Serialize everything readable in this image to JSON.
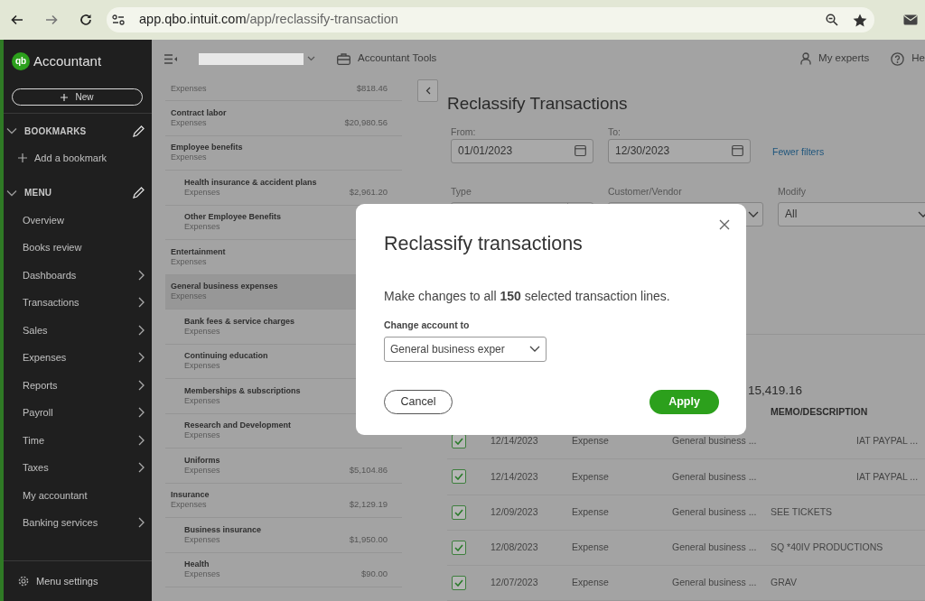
{
  "browser": {
    "url_host": "app.qbo.intuit.com",
    "url_path": "/app/reclassify-transaction"
  },
  "sidebar": {
    "logo_mark": "qb",
    "brand": "Accountant",
    "new_button": "New",
    "sections": [
      {
        "title": "BOOKMARKS",
        "expanded": true,
        "items": [
          {
            "label": "Add a bookmark",
            "kind": "add"
          }
        ]
      },
      {
        "title": "MENU",
        "expanded": true,
        "items": [
          {
            "label": "Overview",
            "kind": "link",
            "has_submenu": false
          },
          {
            "label": "Books review",
            "kind": "link",
            "has_submenu": false
          },
          {
            "label": "Dashboards",
            "kind": "link",
            "has_submenu": true
          },
          {
            "label": "Transactions",
            "kind": "link",
            "has_submenu": true
          },
          {
            "label": "Sales",
            "kind": "link",
            "has_submenu": true
          },
          {
            "label": "Expenses",
            "kind": "link",
            "has_submenu": true
          },
          {
            "label": "Reports",
            "kind": "link",
            "has_submenu": true
          },
          {
            "label": "Payroll",
            "kind": "link",
            "has_submenu": true
          },
          {
            "label": "Time",
            "kind": "link",
            "has_submenu": true
          },
          {
            "label": "Taxes",
            "kind": "link",
            "has_submenu": true
          },
          {
            "label": "My accountant",
            "kind": "link",
            "has_submenu": false
          },
          {
            "label": "Banking services",
            "kind": "link",
            "has_submenu": true
          }
        ]
      }
    ],
    "footer": "Menu settings"
  },
  "topbar": {
    "accountant_tools": "Accountant Tools",
    "my_experts": "My experts",
    "help": "He"
  },
  "accounts": [
    {
      "type": "Expenses",
      "amount": "$818.46",
      "selected": false
    },
    {
      "name": "Contract labor",
      "type": "Expenses",
      "amount": "$20,980.56",
      "selected": false
    },
    {
      "name": "Employee benefits",
      "type": "Expenses",
      "selected": false,
      "children": [
        {
          "name": "Health insurance & accident plans",
          "type": "Expenses",
          "amount": "$2,961.20",
          "selected": false
        },
        {
          "name": "Other Employee Benefits",
          "type": "Expenses",
          "selected": false
        }
      ]
    },
    {
      "name": "Entertainment",
      "type": "Expenses",
      "selected": false
    },
    {
      "name": "General business expenses",
      "type": "Expenses",
      "selected": true,
      "children": [
        {
          "name": "Bank fees & service charges",
          "type": "Expenses",
          "selected": false
        },
        {
          "name": "Continuing education",
          "type": "Expenses",
          "selected": false
        },
        {
          "name": "Memberships & subscriptions",
          "type": "Expenses",
          "selected": false
        },
        {
          "name": "Research and Development",
          "type": "Expenses",
          "selected": false
        },
        {
          "name": "Uniforms",
          "type": "Expenses",
          "amount": "$5,104.86",
          "selected": false
        }
      ]
    },
    {
      "name": "Insurance",
      "type": "Expenses",
      "amount": "$2,129.19",
      "selected": false,
      "children": [
        {
          "name": "Business insurance",
          "type": "Expenses",
          "amount": "$1,950.00",
          "selected": false
        },
        {
          "name": "Health",
          "type": "Expenses",
          "amount": "$90.00",
          "selected": false
        }
      ]
    }
  ],
  "reclassify": {
    "title": "Reclassify Transactions",
    "from_label": "From:",
    "from_value": "01/01/2023",
    "to_label": "To:",
    "to_value": "12/30/2023",
    "fewer_filters": "Fewer filters",
    "filters": [
      {
        "label": "Type",
        "kind": "split"
      },
      {
        "label": "Customer/Vendor",
        "kind": "dropdown"
      },
      {
        "label": "Modify",
        "value": "All",
        "kind": "dropdown"
      }
    ],
    "total": "15,419.16",
    "table": {
      "memo_header": "MEMO/DESCRIPTION",
      "rows": [
        {
          "checked": true,
          "date": "12/14/2023",
          "type": "Expense",
          "account": "General business ...",
          "column_6": "IAT PAYPAL ..."
        },
        {
          "checked": true,
          "date": "12/14/2023",
          "type": "Expense",
          "account": "General business ...",
          "column_6": "IAT PAYPAL ..."
        },
        {
          "checked": true,
          "date": "12/09/2023",
          "type": "Expense",
          "account": "General business ...",
          "memo": "SEE TICKETS"
        },
        {
          "checked": true,
          "date": "12/08/2023",
          "type": "Expense",
          "account": "General business ...",
          "memo": "SQ *40IV PRODUCTIONS"
        },
        {
          "checked": true,
          "date": "12/07/2023",
          "type": "Expense",
          "account": "General business ...",
          "memo": "GRAV"
        }
      ]
    }
  },
  "modal": {
    "title": "Reclassify transactions",
    "message": "Make changes to all **150** selected transaction lines.",
    "field_label": "Change account to",
    "field_value": "General business exper",
    "cancel": "Cancel",
    "apply": "Apply"
  }
}
